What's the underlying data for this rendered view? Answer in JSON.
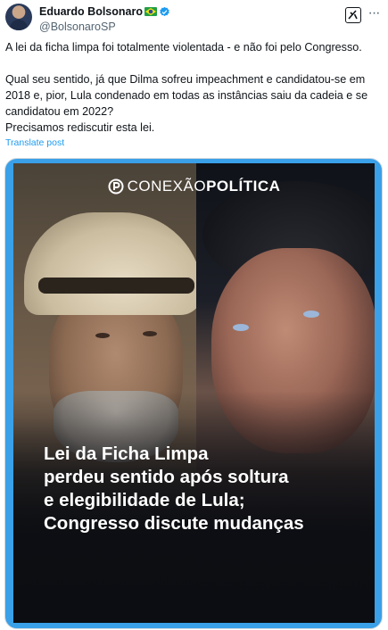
{
  "author": {
    "display_name": "Eduardo Bolsonaro",
    "handle": "@BolsonaroSP",
    "flag_icon": "brazil-flag-icon",
    "verified_icon": "verified-badge-icon",
    "verified_color": "#1d9bf0"
  },
  "actions": {
    "grok_icon": "grok-icon",
    "more_label": "···"
  },
  "post": {
    "paragraph1": "A lei da ficha limpa foi totalmente violentada - e não foi pelo Congresso.",
    "paragraph2": "Qual seu sentido, já que Dilma sofreu impeachment e candidatou-se em 2018 e, pior, Lula condenado em todas as instâncias saiu da cadeia e se candidatou em 2022?",
    "paragraph3": "Precisamos rediscutir esta lei.",
    "translate_label": "Translate post"
  },
  "media": {
    "brand_part1": "CONEXÃO",
    "brand_part2": "POLÍTICA",
    "headline_lines": [
      "Lei da Ficha Limpa",
      "perdeu sentido após soltura",
      "e elegibilidade de Lula;",
      "Congresso discute mudanças"
    ],
    "frame_color": "#3aa0e8"
  }
}
